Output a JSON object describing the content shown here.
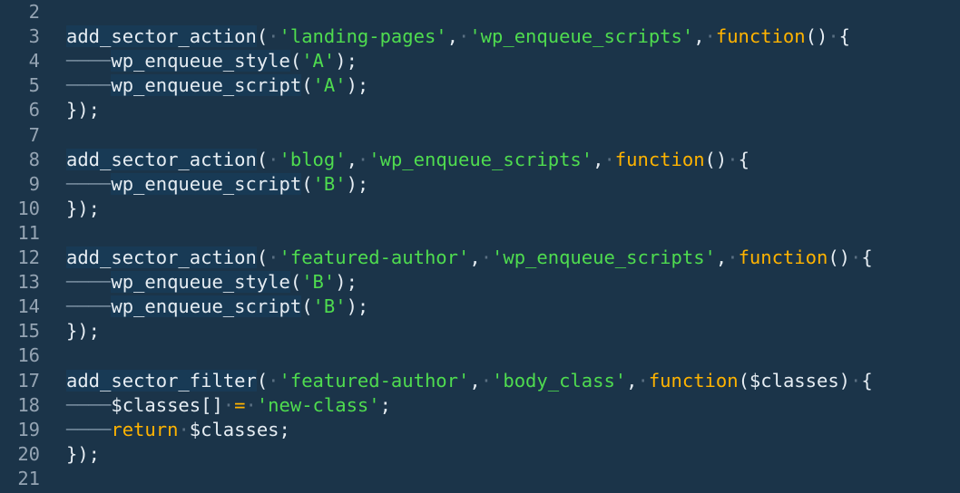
{
  "editor": {
    "lines": [
      {
        "number": "2",
        "tokens": []
      },
      {
        "number": "3",
        "tokens": [
          {
            "t": "fn",
            "v": "add_sector_action"
          },
          {
            "t": "punc",
            "v": "("
          },
          {
            "t": "ws",
            "v": "·"
          },
          {
            "t": "str",
            "v": "'landing-pages'"
          },
          {
            "t": "punc",
            "v": ","
          },
          {
            "t": "ws",
            "v": "·"
          },
          {
            "t": "str",
            "v": "'wp_enqueue_scripts'"
          },
          {
            "t": "punc",
            "v": ","
          },
          {
            "t": "ws",
            "v": "·"
          },
          {
            "t": "kw",
            "v": "function"
          },
          {
            "t": "punc",
            "v": "()"
          },
          {
            "t": "ws",
            "v": "·"
          },
          {
            "t": "punc",
            "v": "{"
          }
        ]
      },
      {
        "number": "4",
        "tokens": [
          {
            "t": "indent",
            "v": "────"
          },
          {
            "t": "fn",
            "v": "wp_enqueue_style"
          },
          {
            "t": "punc",
            "v": "("
          },
          {
            "t": "str",
            "v": "'A'"
          },
          {
            "t": "punc",
            "v": ");"
          }
        ]
      },
      {
        "number": "5",
        "tokens": [
          {
            "t": "indent",
            "v": "────"
          },
          {
            "t": "fn",
            "v": "wp_enqueue_script"
          },
          {
            "t": "punc",
            "v": "("
          },
          {
            "t": "str",
            "v": "'A'"
          },
          {
            "t": "punc",
            "v": ");"
          }
        ]
      },
      {
        "number": "6",
        "tokens": [
          {
            "t": "punc",
            "v": "});"
          }
        ]
      },
      {
        "number": "7",
        "tokens": []
      },
      {
        "number": "8",
        "tokens": [
          {
            "t": "fn",
            "v": "add_sector_action"
          },
          {
            "t": "punc",
            "v": "("
          },
          {
            "t": "ws",
            "v": "·"
          },
          {
            "t": "str",
            "v": "'blog'"
          },
          {
            "t": "punc",
            "v": ","
          },
          {
            "t": "ws",
            "v": "·"
          },
          {
            "t": "str",
            "v": "'wp_enqueue_scripts'"
          },
          {
            "t": "punc",
            "v": ","
          },
          {
            "t": "ws",
            "v": "·"
          },
          {
            "t": "kw",
            "v": "function"
          },
          {
            "t": "punc",
            "v": "()"
          },
          {
            "t": "ws",
            "v": "·"
          },
          {
            "t": "punc",
            "v": "{"
          }
        ]
      },
      {
        "number": "9",
        "tokens": [
          {
            "t": "indent",
            "v": "────"
          },
          {
            "t": "fn",
            "v": "wp_enqueue_script"
          },
          {
            "t": "punc",
            "v": "("
          },
          {
            "t": "str",
            "v": "'B'"
          },
          {
            "t": "punc",
            "v": ");"
          }
        ]
      },
      {
        "number": "10",
        "tokens": [
          {
            "t": "punc",
            "v": "});"
          }
        ]
      },
      {
        "number": "11",
        "tokens": []
      },
      {
        "number": "12",
        "tokens": [
          {
            "t": "fn",
            "v": "add_sector_action"
          },
          {
            "t": "punc",
            "v": "("
          },
          {
            "t": "ws",
            "v": "·"
          },
          {
            "t": "str",
            "v": "'featured-author'"
          },
          {
            "t": "punc",
            "v": ","
          },
          {
            "t": "ws",
            "v": "·"
          },
          {
            "t": "str",
            "v": "'wp_enqueue_scripts'"
          },
          {
            "t": "punc",
            "v": ","
          },
          {
            "t": "ws",
            "v": "·"
          },
          {
            "t": "kw",
            "v": "function"
          },
          {
            "t": "punc",
            "v": "()"
          },
          {
            "t": "ws",
            "v": "·"
          },
          {
            "t": "punc",
            "v": "{"
          }
        ]
      },
      {
        "number": "13",
        "tokens": [
          {
            "t": "indent",
            "v": "────"
          },
          {
            "t": "fn",
            "v": "wp_enqueue_style"
          },
          {
            "t": "punc",
            "v": "("
          },
          {
            "t": "str",
            "v": "'B'"
          },
          {
            "t": "punc",
            "v": ");"
          }
        ]
      },
      {
        "number": "14",
        "tokens": [
          {
            "t": "indent",
            "v": "────"
          },
          {
            "t": "fn",
            "v": "wp_enqueue_script"
          },
          {
            "t": "punc",
            "v": "("
          },
          {
            "t": "str",
            "v": "'B'"
          },
          {
            "t": "punc",
            "v": ");"
          }
        ]
      },
      {
        "number": "15",
        "tokens": [
          {
            "t": "punc",
            "v": "});"
          }
        ]
      },
      {
        "number": "16",
        "tokens": []
      },
      {
        "number": "17",
        "tokens": [
          {
            "t": "fn",
            "v": "add_sector_filter"
          },
          {
            "t": "punc",
            "v": "("
          },
          {
            "t": "ws",
            "v": "·"
          },
          {
            "t": "str",
            "v": "'featured-author'"
          },
          {
            "t": "punc",
            "v": ","
          },
          {
            "t": "ws",
            "v": "·"
          },
          {
            "t": "str",
            "v": "'body_class'"
          },
          {
            "t": "punc",
            "v": ","
          },
          {
            "t": "ws",
            "v": "·"
          },
          {
            "t": "kw",
            "v": "function"
          },
          {
            "t": "punc",
            "v": "("
          },
          {
            "t": "var",
            "v": "$classes"
          },
          {
            "t": "punc",
            "v": ")"
          },
          {
            "t": "ws",
            "v": "·"
          },
          {
            "t": "punc",
            "v": "{"
          }
        ]
      },
      {
        "number": "18",
        "tokens": [
          {
            "t": "indent",
            "v": "────"
          },
          {
            "t": "var",
            "v": "$classes[]"
          },
          {
            "t": "ws",
            "v": "·"
          },
          {
            "t": "kw",
            "v": "="
          },
          {
            "t": "ws",
            "v": "·"
          },
          {
            "t": "str",
            "v": "'new-class'"
          },
          {
            "t": "punc",
            "v": ";"
          }
        ]
      },
      {
        "number": "19",
        "tokens": [
          {
            "t": "indent",
            "v": "────"
          },
          {
            "t": "kw",
            "v": "return"
          },
          {
            "t": "ws",
            "v": "·"
          },
          {
            "t": "var",
            "v": "$classes"
          },
          {
            "t": "punc",
            "v": ";"
          }
        ]
      },
      {
        "number": "20",
        "tokens": [
          {
            "t": "punc",
            "v": "});"
          }
        ]
      },
      {
        "number": "21",
        "tokens": []
      }
    ]
  },
  "colors": {
    "background": "#1b3449",
    "line_number": "#95a4b3",
    "function_name": "#e6edf3",
    "string": "#4fdc4f",
    "keyword": "#ffb300",
    "whitespace_marker": "#5a6f82"
  }
}
